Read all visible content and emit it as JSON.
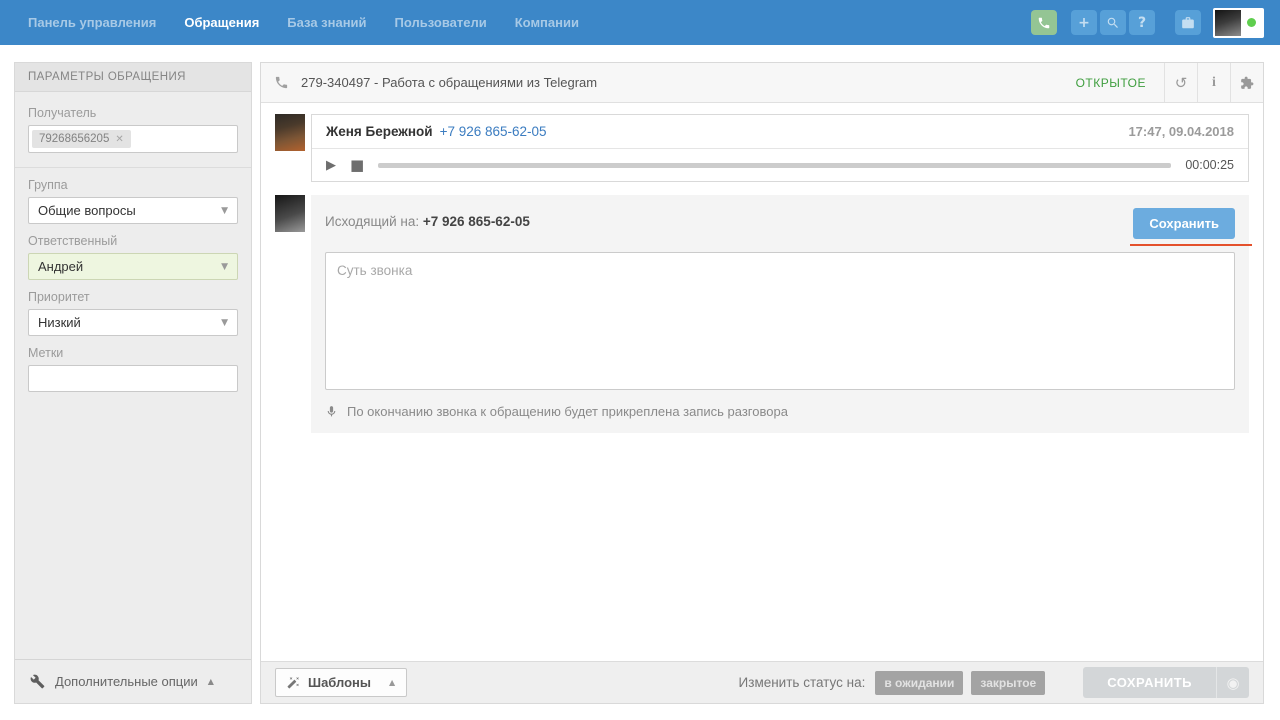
{
  "topnav": {
    "items": [
      {
        "label": "Панель управления",
        "active": false
      },
      {
        "label": "Обращения",
        "active": true
      },
      {
        "label": "База знаний",
        "active": false
      },
      {
        "label": "Пользователи",
        "active": false
      },
      {
        "label": "Компании",
        "active": false
      }
    ],
    "icons": {
      "phone": "phone-handset",
      "plus": "+",
      "search": "magnifier",
      "help": "?",
      "briefcase": "briefcase",
      "user_status_color": "#5fce4e"
    }
  },
  "sidebar": {
    "title": "ПАРАМЕТРЫ ОБРАЩЕНИЯ",
    "recipient": {
      "label": "Получатель",
      "tag": "79268656205",
      "remove_glyph": "✕"
    },
    "group": {
      "label": "Группа",
      "value": "Общие вопросы"
    },
    "assignee": {
      "label": "Ответственный",
      "value": "Андрей",
      "highlight": "#eef6e0"
    },
    "priority": {
      "label": "Приоритет",
      "value": "Низкий"
    },
    "tags": {
      "label": "Метки",
      "value": ""
    },
    "more_options": {
      "label": "Дополнительные опции",
      "collapse_glyph": "▲"
    }
  },
  "ticket": {
    "title": "279-340497 - Работа с обращениями из Telegram",
    "status": "ОТКРЫТОЕ",
    "status_color": "#3f9e3f",
    "icons": {
      "history": "↺",
      "info": "i",
      "merge": "puzzle-piece"
    }
  },
  "messages": {
    "call": {
      "author": "Женя Бережной",
      "phone": "+7 926 865-62-05",
      "timestamp": "17:47, 09.04.2018",
      "duration": "00:00:25",
      "play_glyph": "▶",
      "stop_glyph": "■"
    },
    "outgoing": {
      "direction_label": "Исходящий на:",
      "phone": "+7 926 865-62-05",
      "save_button": "Сохранить",
      "note_placeholder": "Суть звонка",
      "record_note": "По окончанию звонка к обращению будет прикреплена запись разговора"
    }
  },
  "footer": {
    "templates_button": "Шаблоны",
    "templates_collapse_glyph": "▲",
    "change_status_label": "Изменить статус на:",
    "status_pending": "в ожидании",
    "status_closed": "закрытое",
    "save_button": "СОХРАНИТЬ",
    "record_glyph": "◉"
  }
}
